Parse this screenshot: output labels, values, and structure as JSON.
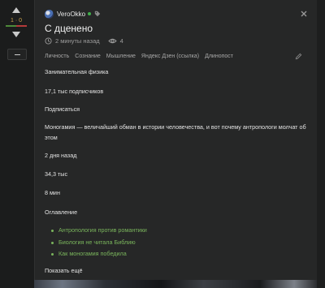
{
  "vote": {
    "score": "1 · 0"
  },
  "post": {
    "author": "VeroOkko",
    "title": "С дценено",
    "time": "2 минуты назад",
    "views": "4",
    "tags": [
      "Личность",
      "Сознание",
      "Мышление",
      "Яндекс Дзен (ссылка)",
      "Длинопост"
    ]
  },
  "body": {
    "line1": "Занимательная физика",
    "line2": "17,1 тыс подписчиков",
    "line3": "Подписаться",
    "line4a": "Моногамия — величайший обман в истории человечества, и вот почему антропологи молчат об",
    "line4b": "этом",
    "line5": "2 дня назад",
    "line6": "34,3 тыс",
    "line7": "8 мин",
    "toc_heading": "Оглавление",
    "toc": [
      "Антропология против романтики",
      "Биология не читала Библию",
      "Как моногамия победила"
    ],
    "more": "Показать ещё"
  },
  "colors": {
    "link": "#7ab55c",
    "online": "#3fae4a",
    "score": "#c9a14a"
  }
}
